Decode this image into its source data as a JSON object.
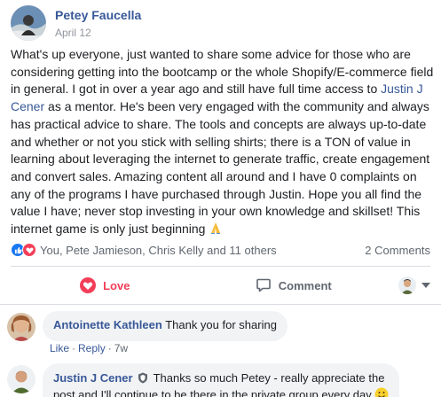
{
  "post": {
    "author": "Petey Faucella",
    "date": "April 12",
    "body_part1": "What's up everyone, just wanted to share some advice for those who are considering getting into the bootcamp or the whole Shopify/E-commerce field in general. I got in over a year ago and still have full time access to ",
    "mention": "Justin J Cener",
    "body_part2": " as a mentor. He's been very engaged with the community and always has practical advice to share. The tools and concepts are always up-to-date and whether or not you stick with selling shirts; there is a TON of value in learning about leveraging the internet to generate traffic, create engagement and convert sales. Amazing content all around and I have 0 complaints on any of the programs I have purchased through Justin. Hope you all find the value I have; never stop investing in your own knowledge and skillset! This internet game is only just beginning",
    "emoji": "pray-emoji"
  },
  "reactions": {
    "icons": [
      "like-icon",
      "love-icon"
    ],
    "names": "You, Pete Jamieson, Chris Kelly and 11 others",
    "comments_count": "2 Comments"
  },
  "actions": {
    "love_label": "Love",
    "comment_label": "Comment"
  },
  "comments": [
    {
      "author": "Antoinette Kathleen",
      "text": "Thank you for sharing",
      "like_label": "Like",
      "reply_label": "Reply",
      "time": "7w"
    },
    {
      "author": "Justin J Cener",
      "badge": "admin-shield-icon",
      "text_line1": "Thanks so much Petey - really appreciate the",
      "text_line2": "post and I'll continue to be there in the private group every day"
    }
  ],
  "colors": {
    "link": "#385898",
    "love": "#f33e58",
    "like": "#1877f2",
    "muted": "#606770",
    "bubble": "#f2f3f5"
  }
}
